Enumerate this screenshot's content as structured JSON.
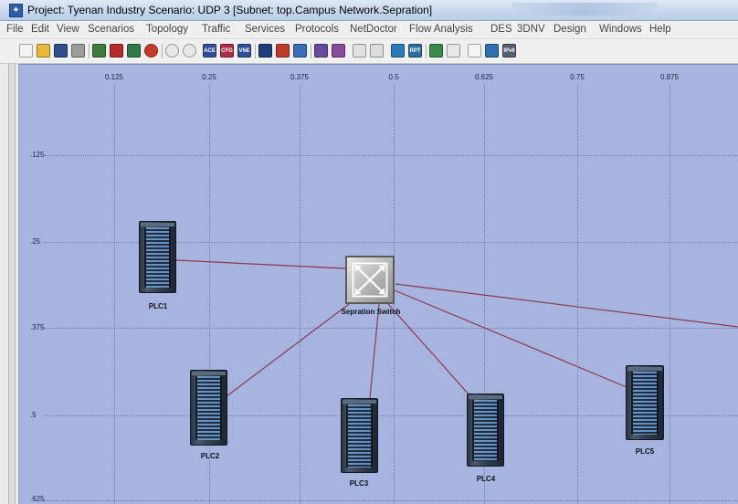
{
  "window": {
    "title": "Project: Tyenan Industry Scenario: UDP 3  [Subnet: top.Campus Network.Sepration]",
    "app_icon": "star-icon"
  },
  "menu": [
    "File",
    "Edit",
    "View",
    "Scenarios",
    "Topology",
    "Traffic",
    "Services",
    "Protocols",
    "NetDoctor",
    "Flow Analysis",
    "DES",
    "3DNV",
    "Design",
    "Windows",
    "Help"
  ],
  "toolbar": {
    "icons": [
      "new-project-icon",
      "open-folder-icon",
      "save-icon",
      "print-icon",
      "object-palette-icon",
      "failure-node-icon",
      "recover-node-icon",
      "verify-links-icon",
      "zoom-in-icon",
      "zoom-out-icon",
      "ace-icon",
      "cfg-icon",
      "vne-icon",
      "configure-run-des-icon",
      "view-results-icon",
      "hide-statistics-icon",
      "mark-nodes-icon",
      "unmark-nodes-icon",
      "flow-analysis-icon",
      "netdoctor-icon",
      "3dnv-icon",
      "report-icon",
      "compare-results-icon",
      "chart-icon",
      "info-icon",
      "web-report-icon",
      "ipv6-icon"
    ],
    "text_badges": {
      "ace-icon": "ACE",
      "cfg-icon": "CFG",
      "vne-icon": "VNE",
      "report-icon": "RPT",
      "ipv6-icon": "IPv6"
    }
  },
  "workspace": {
    "background": "#a7b4e0",
    "x_ruler": [
      "0.125",
      "0.25",
      "0.375",
      "0.5",
      "0.625",
      "0.75",
      "0.875"
    ],
    "y_ruler": [
      ".125",
      ".25",
      ".375",
      ".5",
      ".625"
    ],
    "link_color": "#8c3a4a",
    "nodes": {
      "switch": {
        "label": "Sepration Switch",
        "type": "switch"
      },
      "plc1": {
        "label": "PLC1",
        "type": "server"
      },
      "plc2": {
        "label": "PLC2",
        "type": "server"
      },
      "plc3": {
        "label": "PLC3",
        "type": "server"
      },
      "plc4": {
        "label": "PLC4",
        "type": "server"
      },
      "plc5": {
        "label": "PLC5",
        "type": "server"
      }
    }
  }
}
